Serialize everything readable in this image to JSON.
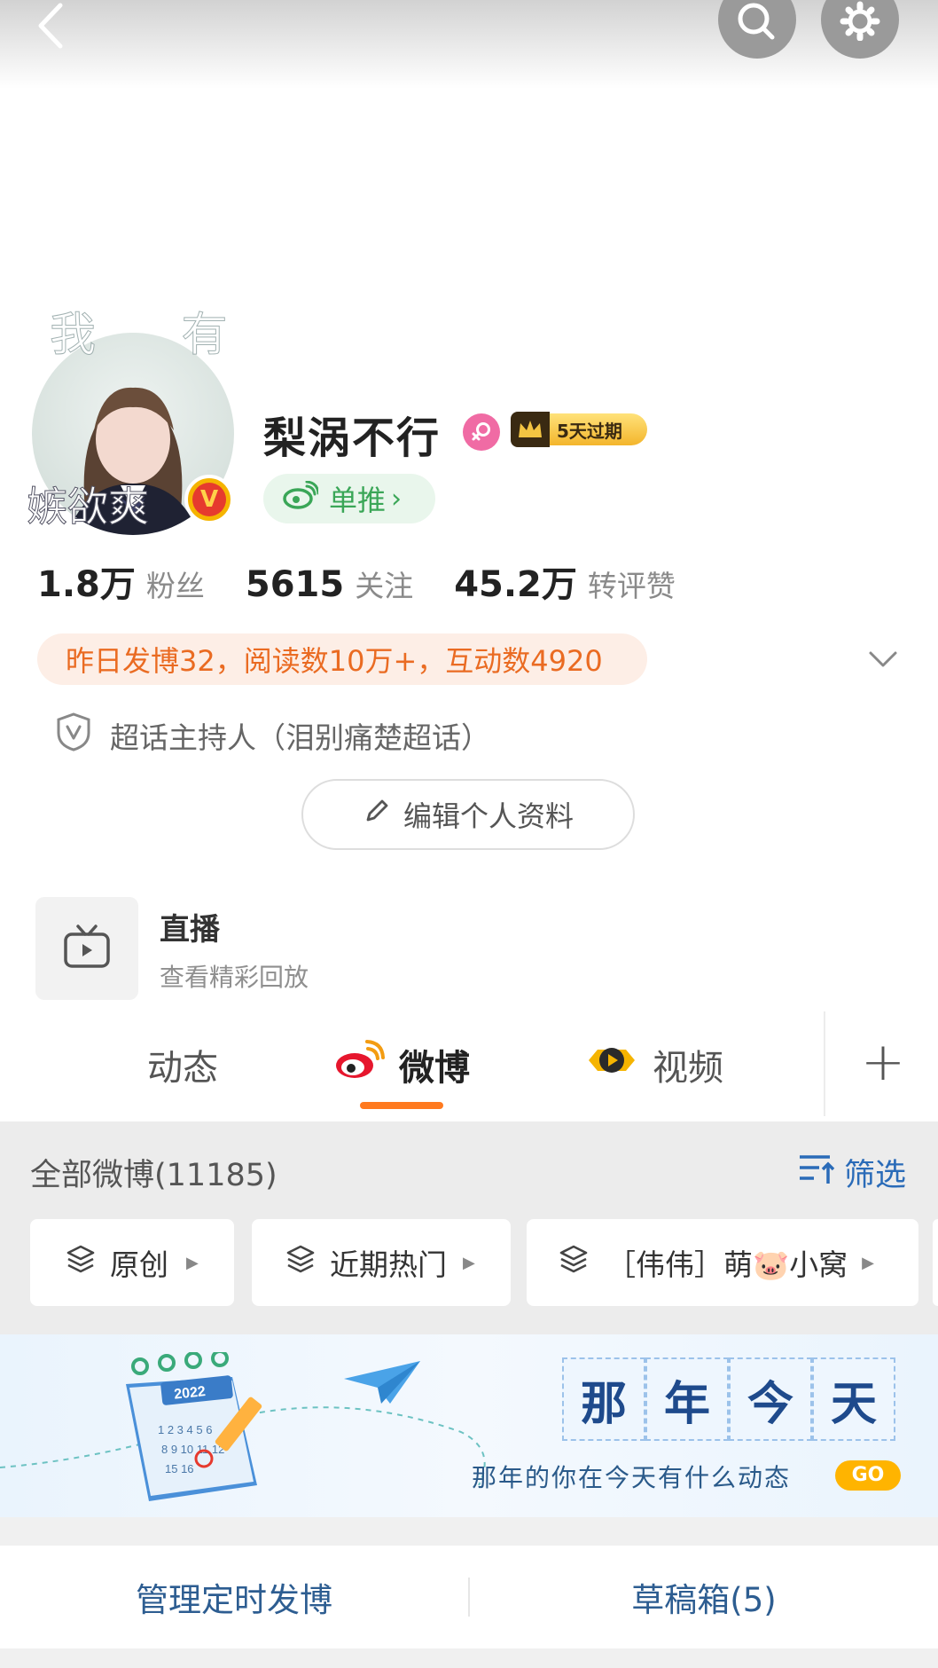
{
  "topbar": {
    "back_icon": "back-arrow-icon",
    "search_icon": "search-icon",
    "settings_icon": "gear-icon"
  },
  "profile": {
    "avatar_text_top": "我 有",
    "avatar_text_bottom": "嫉欲爽",
    "name": "梨涡不行",
    "gender_icon": "female-icon",
    "vip_badge": "5天过期",
    "recommend_label": "单推",
    "recommend_chevron": "›"
  },
  "stats": [
    {
      "value": "1.8万",
      "label": "粉丝"
    },
    {
      "value": "5615",
      "label": "关注"
    },
    {
      "value": "45.2万",
      "label": "转评赞"
    }
  ],
  "highlight": "昨日发博32，阅读数10万+，互动数4920",
  "host_label": "超话主持人（泪别痛楚超话）",
  "edit_profile": "编辑个人资料",
  "live": {
    "title": "直播",
    "subtitle": "查看精彩回放"
  },
  "tabs": [
    {
      "label": "动态"
    },
    {
      "label": "微博"
    },
    {
      "label": "视频"
    }
  ],
  "tab_add": "+",
  "feed": {
    "all_count": "全部微博(11185)",
    "filter": "筛选",
    "chips": [
      {
        "label": "原创"
      },
      {
        "label": "近期热门"
      },
      {
        "label": "［伟伟］萌🐷小窝"
      }
    ]
  },
  "banner": {
    "calendar_year": "2022",
    "chars": [
      "那",
      "年",
      "今",
      "天"
    ],
    "subtitle": "那年的你在今天有什么动态",
    "go": "GO"
  },
  "bottom": {
    "scheduled": "管理定时发博",
    "drafts": "草稿箱(5)"
  },
  "colors": {
    "accent_orange": "#ff7a1f",
    "link_blue": "#2a6bb8",
    "green": "#3aa657",
    "highlight_text": "#ea6b22"
  }
}
